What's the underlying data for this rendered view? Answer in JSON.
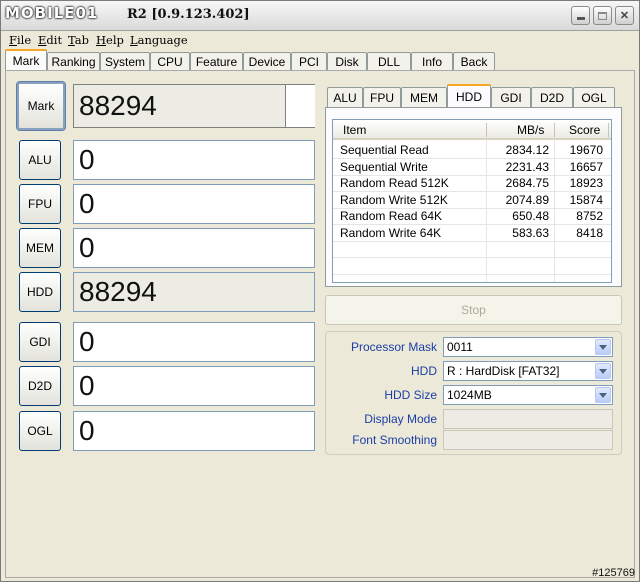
{
  "window": {
    "logo": "MOBILE01",
    "title": "R2 [0.9.123.402]"
  },
  "menu": [
    "File",
    "Edit",
    "Tab",
    "Help",
    "Language"
  ],
  "main_tabs": [
    "Mark",
    "Ranking",
    "System",
    "CPU",
    "Feature",
    "Device",
    "PCI",
    "Disk",
    "DLL",
    "Info",
    "Back"
  ],
  "benchmarks": [
    {
      "label": "Mark",
      "score": "88294"
    },
    {
      "label": "ALU",
      "score": "0"
    },
    {
      "label": "FPU",
      "score": "0"
    },
    {
      "label": "MEM",
      "score": "0"
    },
    {
      "label": "HDD",
      "score": "88294"
    },
    {
      "label": "GDI",
      "score": "0"
    },
    {
      "label": "D2D",
      "score": "0"
    },
    {
      "label": "OGL",
      "score": "0"
    }
  ],
  "sub_tabs": [
    "ALU",
    "FPU",
    "MEM",
    "HDD",
    "GDI",
    "D2D",
    "OGL"
  ],
  "results": {
    "headers": [
      "Item",
      "MB/s",
      "Score"
    ],
    "rows": [
      [
        "Sequential Read",
        "2834.12",
        "19670"
      ],
      [
        "Sequential Write",
        "2231.43",
        "16657"
      ],
      [
        "Random Read 512K",
        "2684.75",
        "18923"
      ],
      [
        "Random Write 512K",
        "2074.89",
        "15874"
      ],
      [
        "Random Read 64K",
        "650.48",
        "8752"
      ],
      [
        "Random Write 64K",
        "583.63",
        "8418"
      ]
    ]
  },
  "stop_label": "Stop",
  "settings": {
    "processor_mask_label": "Processor Mask",
    "processor_mask_value": "0011",
    "hdd_label": "HDD",
    "hdd_value": "R : HardDisk [FAT32]",
    "hdd_size_label": "HDD Size",
    "hdd_size_value": "1024MB",
    "display_mode_label": "Display Mode",
    "font_smoothing_label": "Font Smoothing"
  },
  "watermark": "#125769",
  "colors": {
    "active_tab_accent": "#f5a624",
    "setting_label": "#1b3ea8"
  }
}
